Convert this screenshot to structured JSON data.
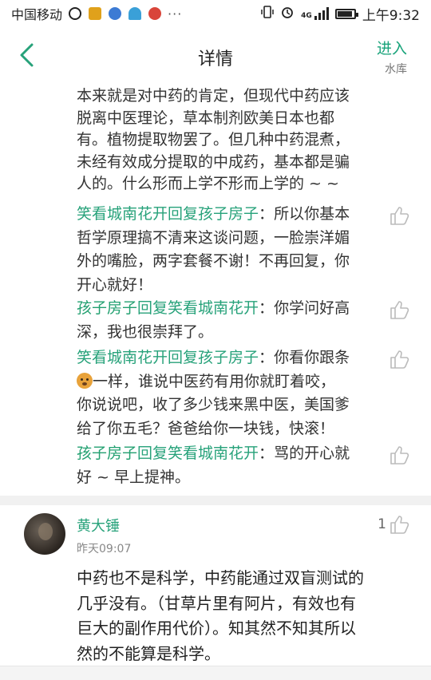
{
  "status_bar": {
    "carrier": "中国移动",
    "time": "上午9:32",
    "signal_label": "4G"
  },
  "header": {
    "title": "详情",
    "enter_label": "进入",
    "enter_sub": "水库"
  },
  "post": {
    "body_lines": [
      "本来就是对中药的肯定，但现代中药应该",
      "脱离中医理论，草本制剂欧美日本也都",
      "有。植物提取物罢了。但几种中药混煮，",
      "未经有效成分提取的中成药，基本都是骗",
      "人的。什么形而上学不形而上学的 ~ ~"
    ]
  },
  "replies": [
    {
      "from": "笑看城南花开",
      "verb": "回复",
      "to": "孩子房子",
      "text_lines": [
        "所以你基本",
        "哲学原理搞不清来这谈问题，一脸崇洋媚",
        "外的嘴脸，两字套餐不谢！不再回复，你",
        "开心就好！"
      ]
    },
    {
      "from": "孩子房子",
      "verb": "回复",
      "to": "笑看城南花开",
      "text_lines": [
        "你学问好高",
        "深，我也很崇拜了。"
      ]
    },
    {
      "from": "笑看城南花开",
      "verb": "回复",
      "to": "孩子房子",
      "text_lines": [
        "你看你跟条",
        "一样，谁说中医药有用你就盯着咬，",
        "你说说吧，收了多少钱来黑中医，美国爹",
        "给了你五毛？爸爸给你一块钱，快滚！"
      ]
    },
    {
      "from": "孩子房子",
      "verb": "回复",
      "to": "笑看城南花开",
      "text_lines": [
        "骂的开心就",
        "好 ~ 早上提神。"
      ]
    }
  ],
  "comment": {
    "author": "黄大锤",
    "time": "昨天09:07",
    "likes": "1",
    "text_lines": [
      "中药也不是科学，中药能通过双盲测试的",
      "几乎没有。（甘草片里有阿片，有效也有",
      "巨大的副作用代价）。知其然不知其所以",
      "然的不能算是科学。"
    ]
  },
  "colors": {
    "accent": "#27a27a",
    "text": "#333333",
    "divider": "#f1f1f1"
  }
}
